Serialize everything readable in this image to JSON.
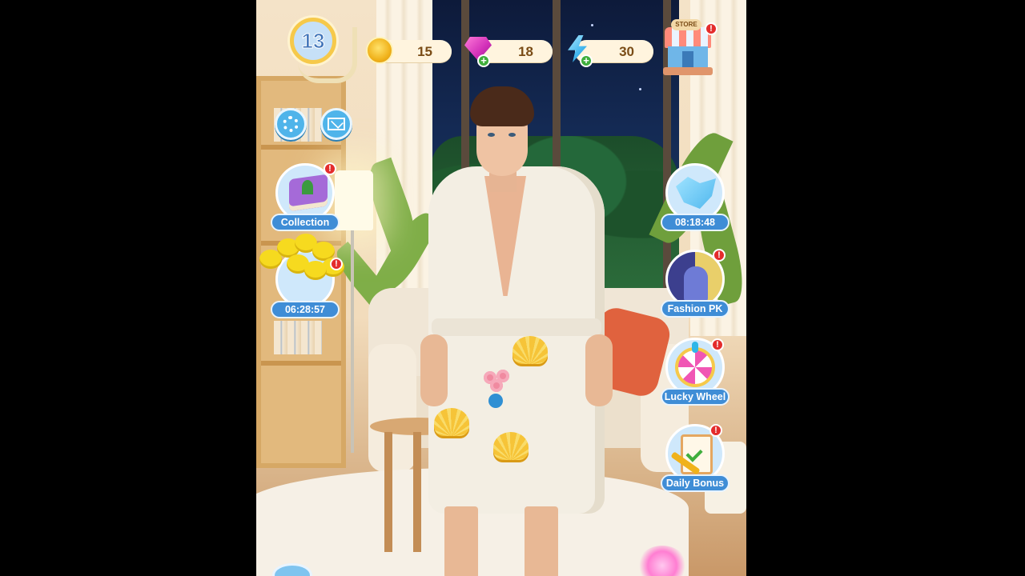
{
  "hud": {
    "level": "13",
    "coins": "15",
    "gems": "18",
    "energy": "30",
    "store_label": "STORE"
  },
  "features": {
    "collection": {
      "label": "Collection",
      "alert": "!"
    },
    "flower_event": {
      "timer": "06:28:57",
      "alert": "!"
    },
    "cubes_event": {
      "timer": "08:18:48"
    },
    "fashion_pk": {
      "label": "Fashion PK",
      "alert": "!"
    },
    "lucky_wheel": {
      "label": "Lucky Wheel",
      "alert": "!"
    },
    "daily_bonus": {
      "label": "Daily Bonus",
      "alert": "!"
    }
  },
  "store_alert": "!",
  "icons": {
    "settings": "gear-icon",
    "mail": "mail-icon",
    "coin": "coin-icon",
    "gem": "gem-icon",
    "energy": "lightning-icon",
    "store": "store-icon"
  },
  "colors": {
    "label_blue": "#3f8dd6",
    "alert_red": "#e42c2c",
    "currency_text": "#7a4c16"
  }
}
